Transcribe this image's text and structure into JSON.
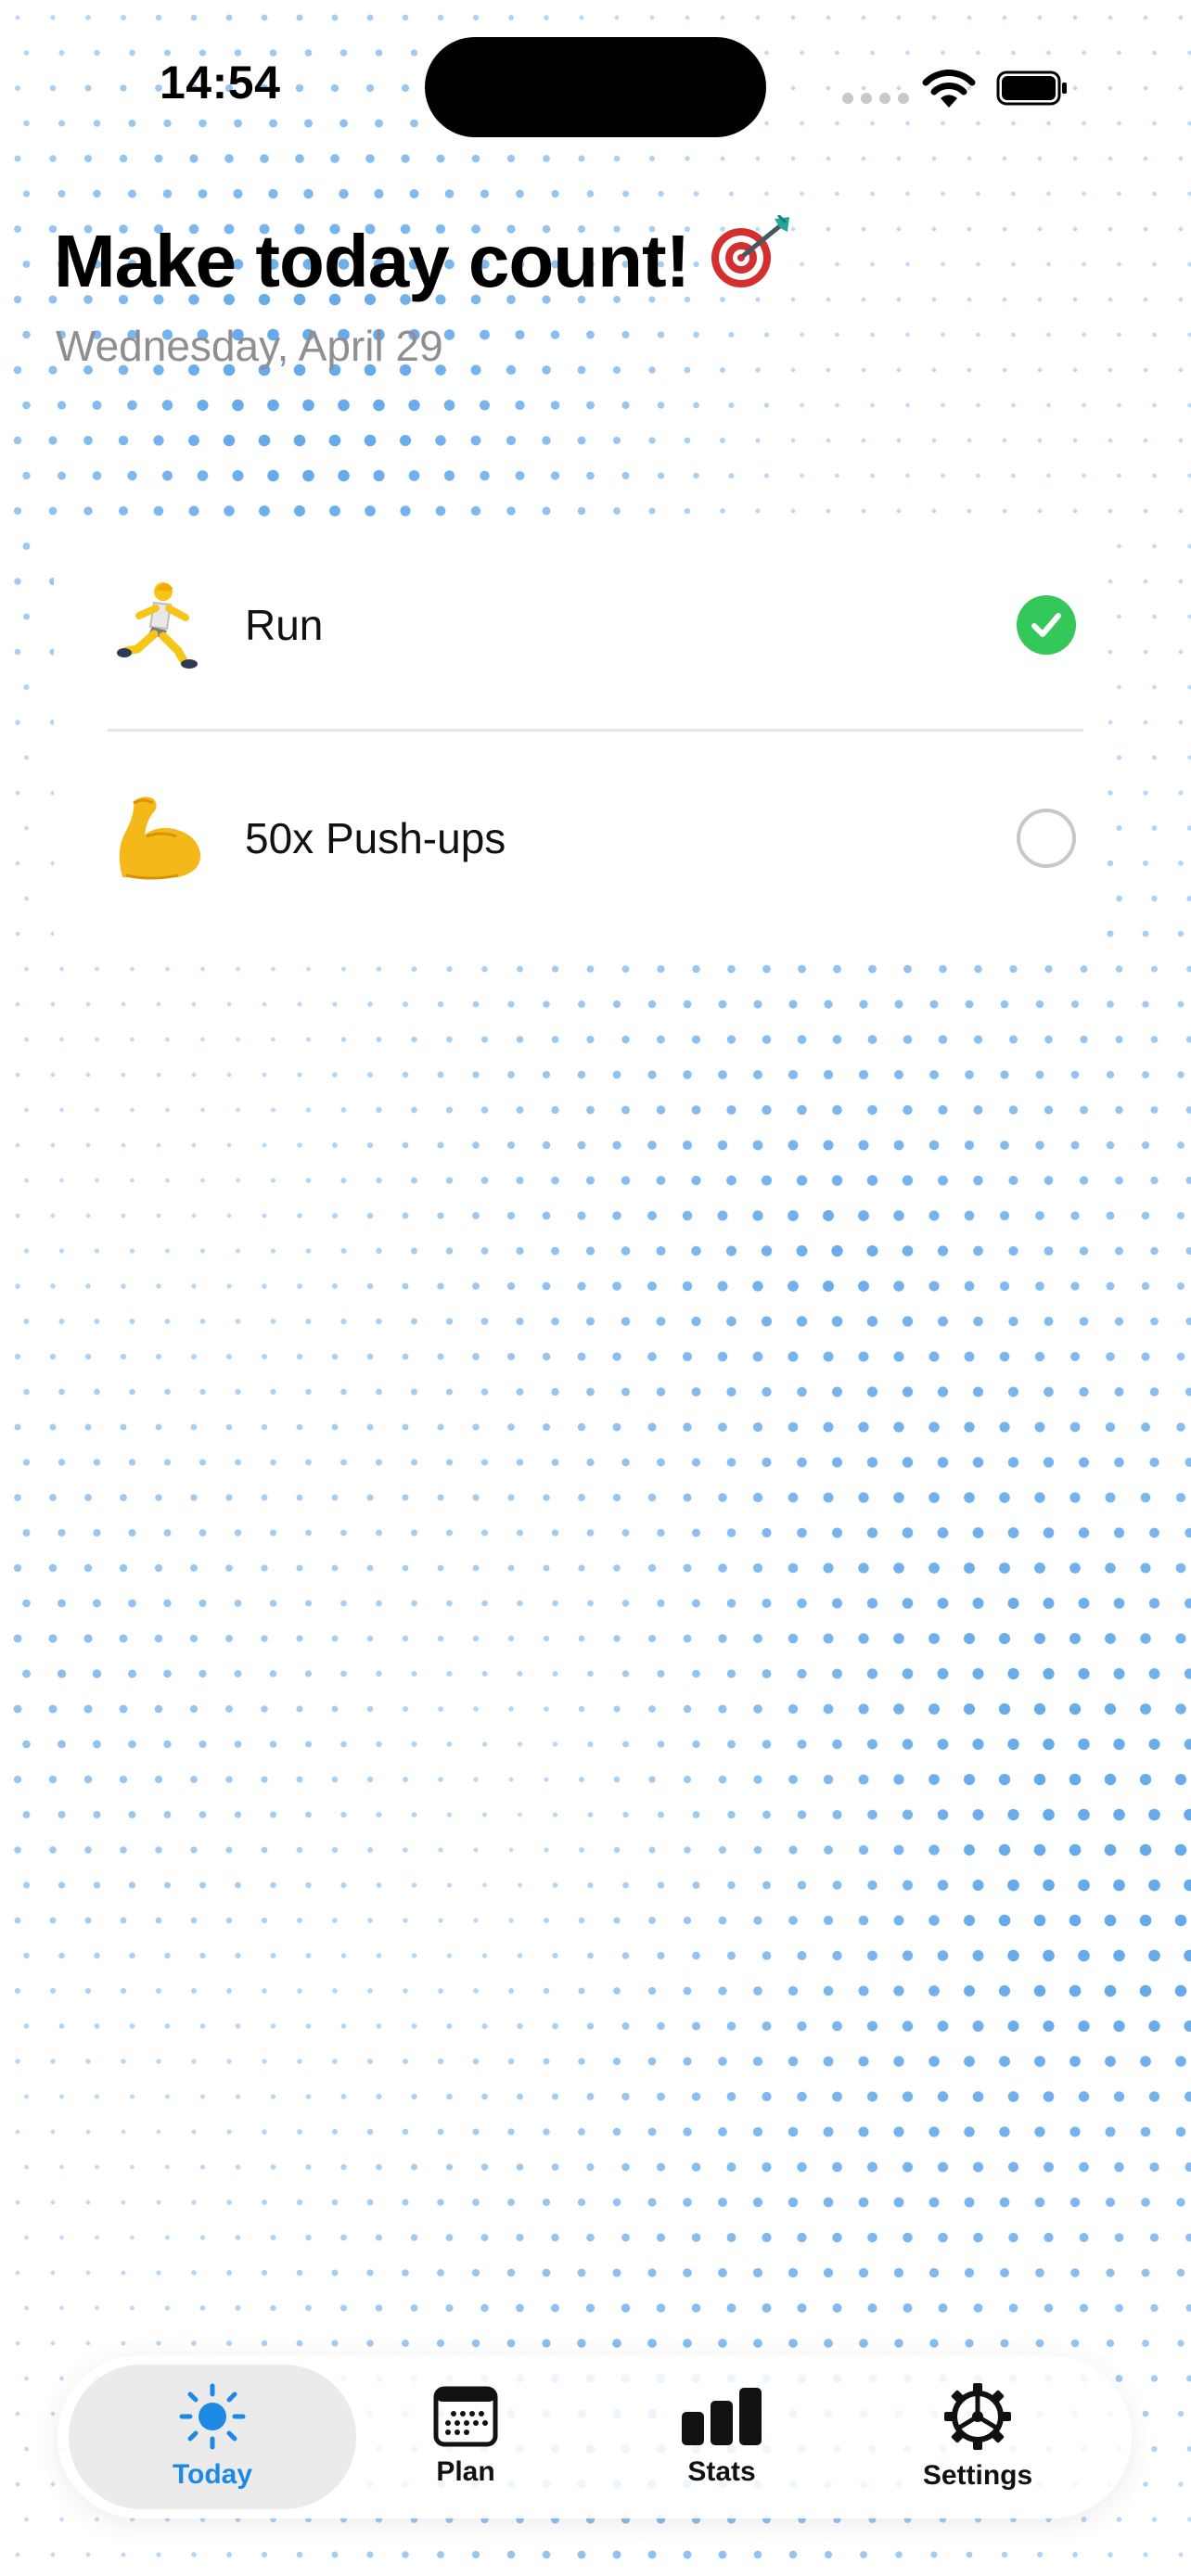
{
  "status_bar": {
    "time": "14:54"
  },
  "header": {
    "title": "Make today count!",
    "title_emoji": "target-dart-icon",
    "date": "Wednesday, April 29"
  },
  "tasks": [
    {
      "label": "Run",
      "emoji": "runner-icon",
      "done": true
    },
    {
      "label": "50x Push-ups",
      "emoji": "flexed-biceps-icon",
      "done": false
    }
  ],
  "tab_bar": {
    "tabs": [
      {
        "label": "Today",
        "icon": "sun-icon",
        "active": true
      },
      {
        "label": "Plan",
        "icon": "calendar-icon",
        "active": false
      },
      {
        "label": "Stats",
        "icon": "bar-chart-icon",
        "active": false
      },
      {
        "label": "Settings",
        "icon": "gear-icon",
        "active": false
      }
    ]
  },
  "colors": {
    "accent": "#1e88e5",
    "done_green": "#34c759",
    "dot_blue": "#4a9be8",
    "subtitle_gray": "#8e8e93"
  }
}
